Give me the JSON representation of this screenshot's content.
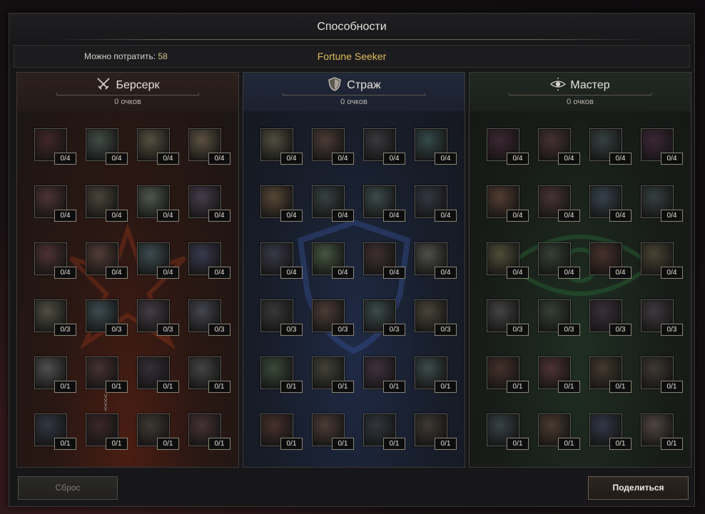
{
  "window": {
    "title": "Способности"
  },
  "info": {
    "spend_label": "Можно потратить:",
    "spend_value": "58",
    "build_name": "Fortune Seeker"
  },
  "trees": [
    {
      "id": "berserker",
      "name": "Берсерк",
      "icon": "crossed-swords-icon",
      "points": "0 очков",
      "accent": "#8a3a22",
      "rows": [
        [
          "0/4",
          "0/4",
          "0/4",
          "0/4"
        ],
        [
          "0/4",
          "0/4",
          "0/4",
          "0/4"
        ],
        [
          "0/4",
          "0/4",
          "0/4",
          "0/4"
        ],
        [
          "0/3",
          "0/3",
          "0/3",
          "0/3"
        ],
        [
          "0/1",
          "0/1",
          "0/1",
          "0/1"
        ],
        [
          "0/1",
          "0/1",
          "0/1",
          "0/1"
        ]
      ],
      "skill_colors": [
        [
          "#7a2a2a",
          "#4a6a5a",
          "#7a6a3a",
          "#8a6a3a"
        ],
        [
          "#8a3a3a",
          "#6a5a3a",
          "#5a7a5a",
          "#6a4a7a"
        ],
        [
          "#8a3a3a",
          "#8a4a3a",
          "#3a6a7a",
          "#4a4a8a"
        ],
        [
          "#6a6a4a",
          "#3a6a7a",
          "#6a4a6a",
          "#5a5a7a"
        ],
        [
          "#6a6a6a",
          "#7a3a3a",
          "#4a3a5a",
          "#5a5a5a"
        ],
        [
          "#3a4a6a",
          "#6a2a3a",
          "#5a4a3a",
          "#7a3a4a"
        ]
      ]
    },
    {
      "id": "guardian",
      "name": "Страж",
      "icon": "shield-icon",
      "points": "0 очков",
      "accent": "#2a3a6a",
      "rows": [
        [
          "0/4",
          "0/4",
          "0/4",
          "0/4"
        ],
        [
          "0/4",
          "0/4",
          "0/4",
          "0/4"
        ],
        [
          "0/4",
          "0/4",
          "0/4",
          "0/4"
        ],
        [
          "0/3",
          "0/3",
          "0/3",
          "0/3"
        ],
        [
          "0/1",
          "0/1",
          "0/1",
          "0/1"
        ],
        [
          "0/1",
          "0/1",
          "0/1",
          "0/1"
        ]
      ],
      "skill_colors": [
        [
          "#6a6a3a",
          "#7a4a3a",
          "#4a4a5a",
          "#2a6a6a"
        ],
        [
          "#8a5a2a",
          "#3a5a5a",
          "#3a6a6a",
          "#3a4a6a"
        ],
        [
          "#4a4a7a",
          "#4a7a3a",
          "#6a3a3a",
          "#6a6a5a"
        ],
        [
          "#4a4a4a",
          "#7a4a3a",
          "#3a6a6a",
          "#6a5a3a"
        ],
        [
          "#3a6a3a",
          "#5a5a3a",
          "#6a3a6a",
          "#3a6a6a"
        ],
        [
          "#7a3a2a",
          "#7a4a3a",
          "#3a4a5a",
          "#5a4a3a"
        ]
      ]
    },
    {
      "id": "master",
      "name": "Мастер",
      "icon": "eye-icon",
      "points": "0 очков",
      "accent": "#2a4a2a",
      "rows": [
        [
          "0/4",
          "0/4",
          "0/4",
          "0/4"
        ],
        [
          "0/4",
          "0/4",
          "0/4",
          "0/4"
        ],
        [
          "0/4",
          "0/4",
          "0/4",
          "0/4"
        ],
        [
          "0/3",
          "0/3",
          "0/3",
          "0/3"
        ],
        [
          "0/1",
          "0/1",
          "0/1",
          "0/1"
        ],
        [
          "0/1",
          "0/1",
          "0/1",
          "0/1"
        ]
      ],
      "skill_colors": [
        [
          "#6a2a4a",
          "#7a3a3a",
          "#3a5a5a",
          "#6a2a5a"
        ],
        [
          "#8a4a2a",
          "#7a3a4a",
          "#3a5a7a",
          "#3a5a5a"
        ],
        [
          "#6a6a2a",
          "#3a5a3a",
          "#7a3a2a",
          "#6a5a2a"
        ],
        [
          "#5a5a5a",
          "#3a5a3a",
          "#5a3a5a",
          "#5a4a5a"
        ],
        [
          "#7a3a2a",
          "#8a3a3a",
          "#6a4a2a",
          "#5a4a3a"
        ],
        [
          "#3a5a6a",
          "#7a4a2a",
          "#3a4a7a",
          "#7a5a4a"
        ]
      ]
    }
  ],
  "buttons": {
    "reset": "Сброс",
    "share": "Поделиться"
  }
}
